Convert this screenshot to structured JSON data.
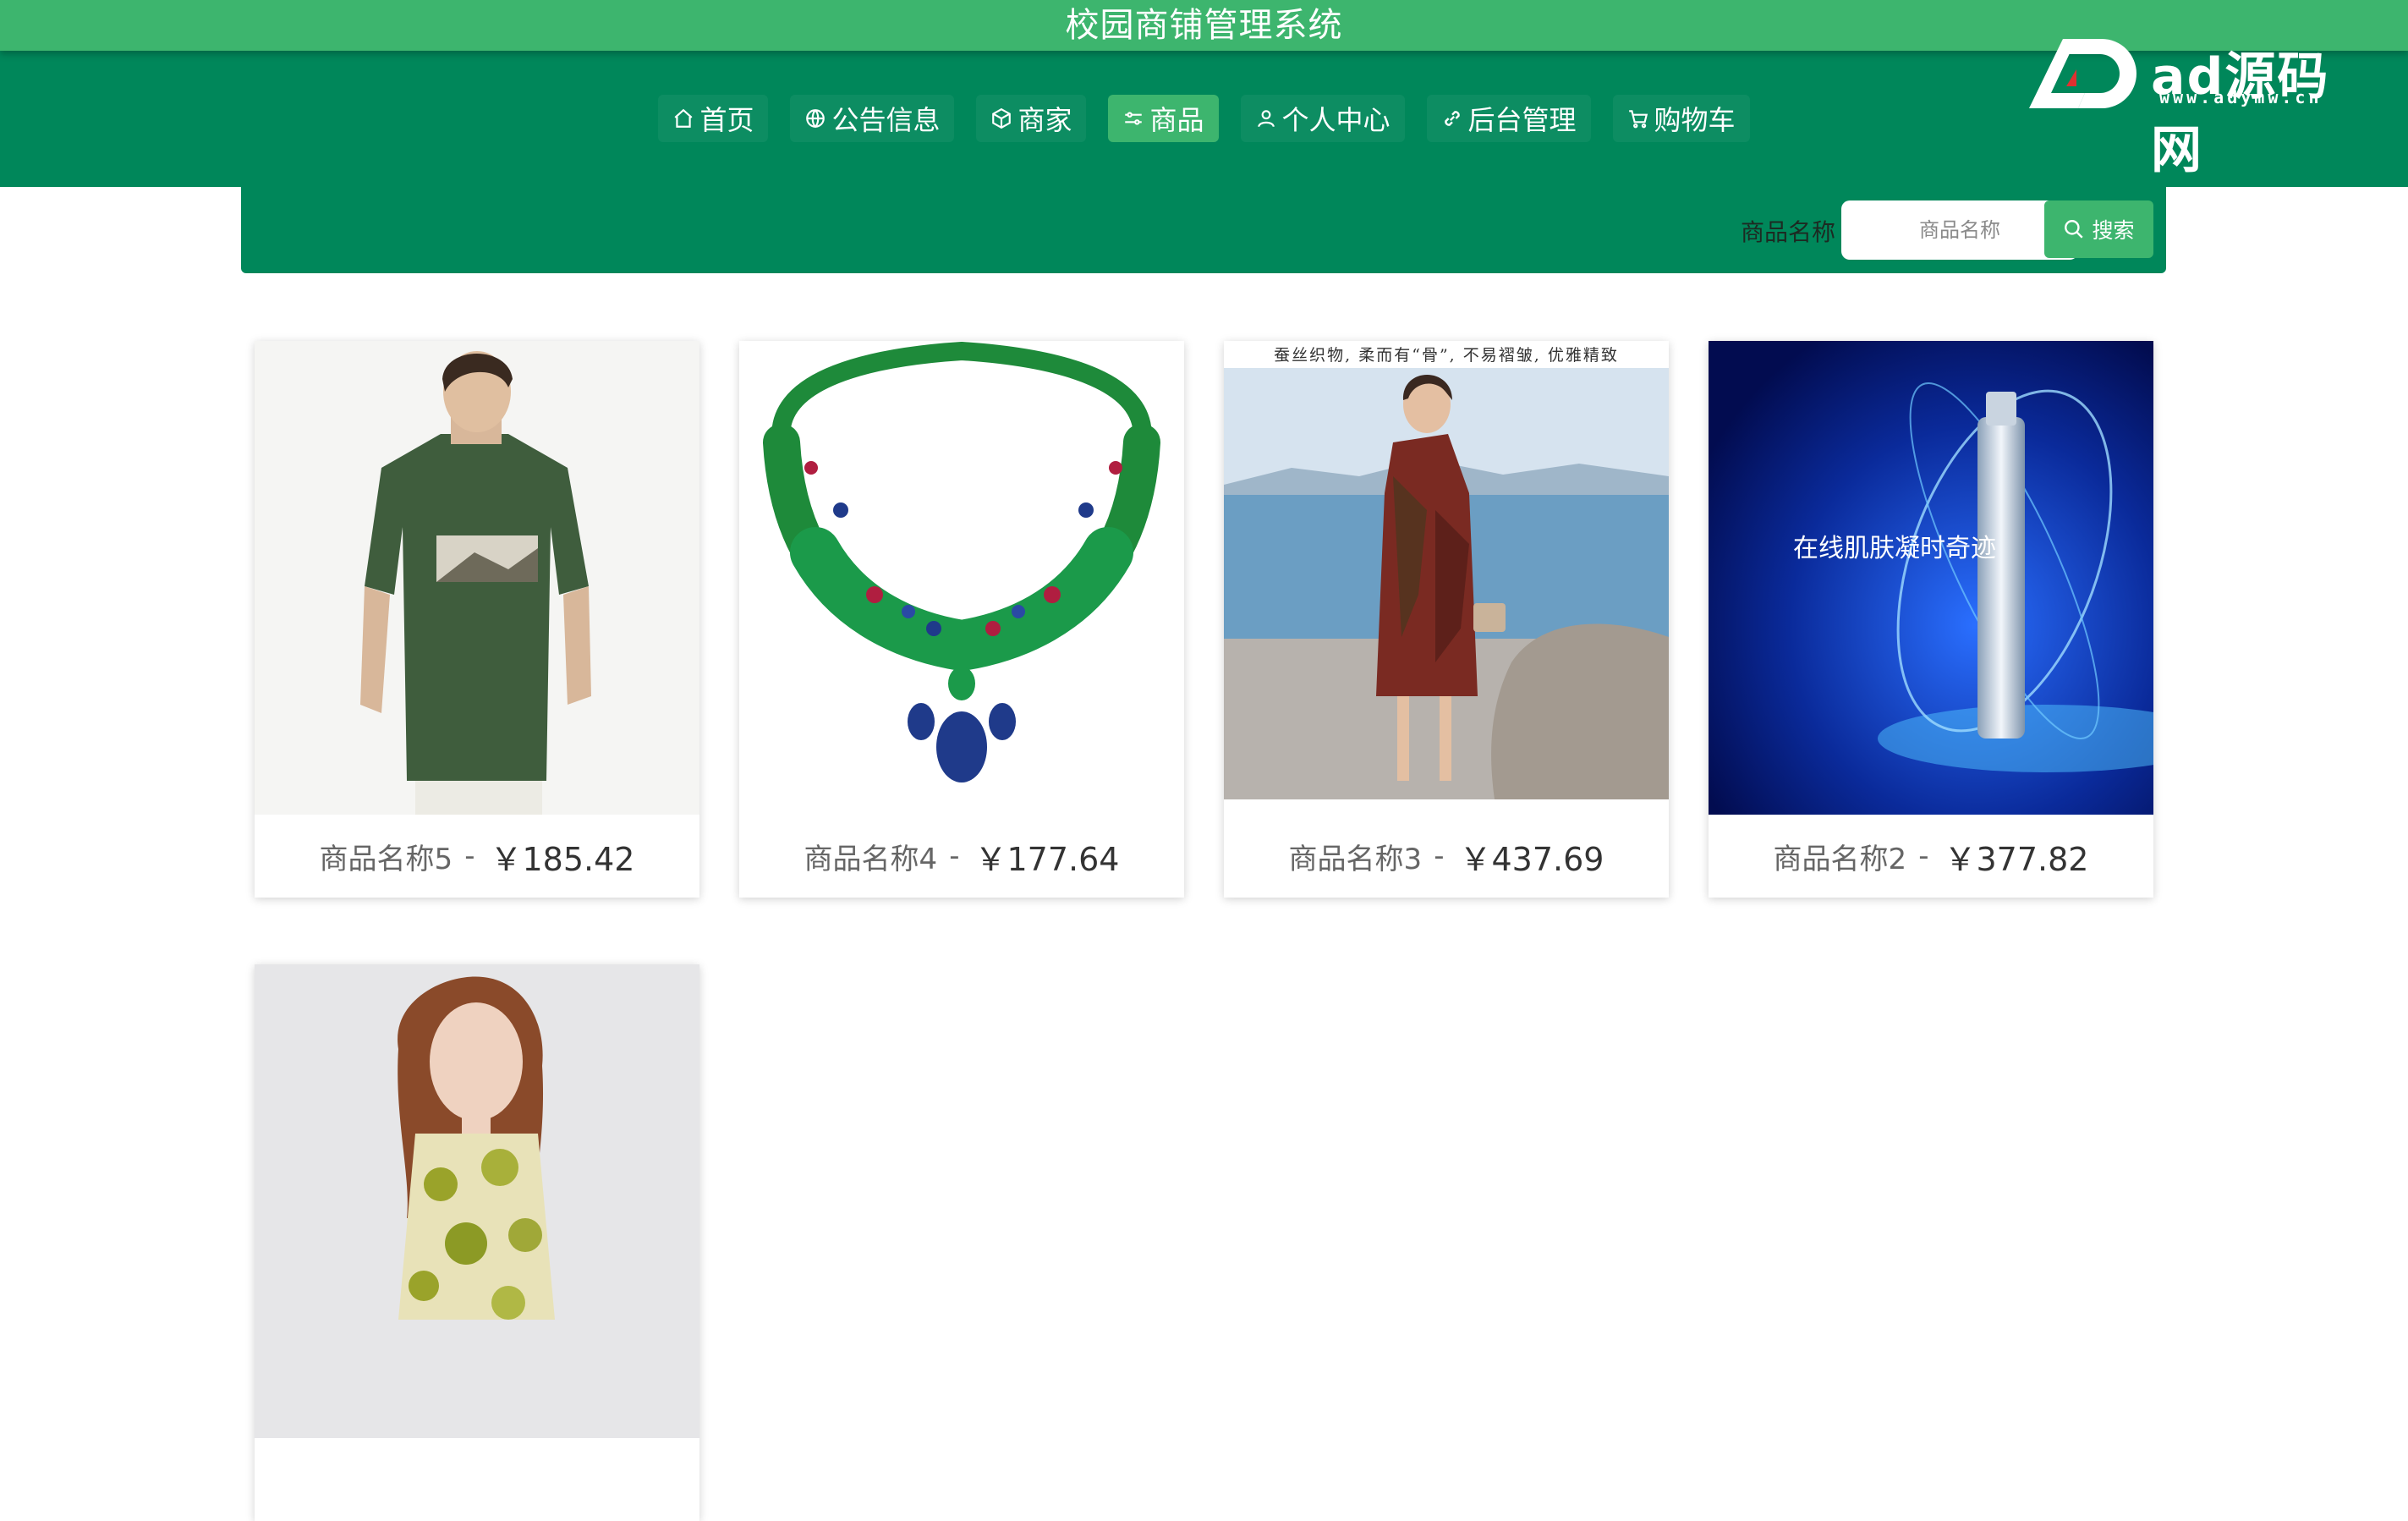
{
  "header": {
    "title": "校园商铺管理系统"
  },
  "nav": {
    "items": [
      {
        "label": "首页",
        "icon": "home-icon"
      },
      {
        "label": "公告信息",
        "icon": "globe-icon"
      },
      {
        "label": "商家",
        "icon": "box-icon"
      },
      {
        "label": "商品",
        "icon": "sliders-icon",
        "active": true
      },
      {
        "label": "个人中心",
        "icon": "user-icon"
      },
      {
        "label": "后台管理",
        "icon": "link-icon"
      },
      {
        "label": "购物车",
        "icon": "cart-icon"
      }
    ]
  },
  "logo": {
    "text": "ad源码网",
    "sub": "www.adymw.cn"
  },
  "search": {
    "label": "商品名称",
    "placeholder": "商品名称",
    "button": "搜索"
  },
  "products": [
    {
      "name": "商品名称5",
      "sep": "-",
      "price": "￥185.42",
      "image": "man in green t-shirt"
    },
    {
      "name": "商品名称4",
      "sep": "-",
      "price": "￥177.64",
      "image": "gemstone necklace"
    },
    {
      "name": "商品名称3",
      "sep": "-",
      "price": "￥437.69",
      "image": "woman in floral dress by sea",
      "image_text": "蚕丝织物, 柔而有“骨”, 不易褶皱, 优雅精致"
    },
    {
      "name": "商品名称2",
      "sep": "-",
      "price": "￥377.82",
      "image": "skincare bottle on blue",
      "image_text": "在线肌肤凝时奇迹"
    },
    {
      "name": "",
      "sep": "",
      "price": "",
      "image": "woman in yellow patterned dress"
    }
  ],
  "colors": {
    "title_bar": "#3db56e",
    "nav_bar": "#00875a",
    "active": "#3db56e"
  }
}
